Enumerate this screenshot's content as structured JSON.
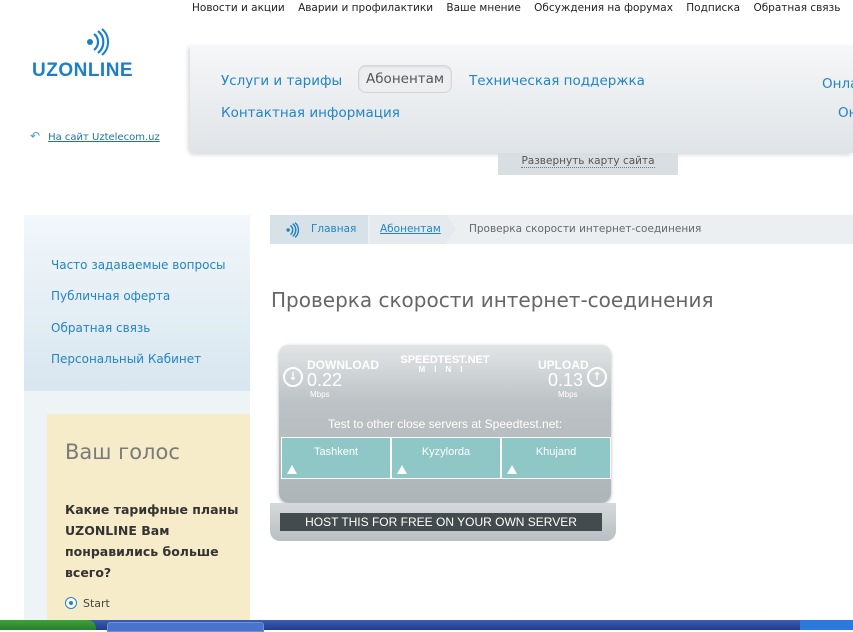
{
  "top_links": [
    "Новости и акции",
    "Аварии и профилактики",
    "Ваше мнение",
    "Обсуждения на форумах",
    "Подписка",
    "Обратная связь"
  ],
  "logo": {
    "text": "UZONLINE"
  },
  "back_link": "На сайт Uztelecom.uz",
  "nav": {
    "items": [
      "Услуги и тарифы",
      "Абонентам",
      "Техническая поддержка",
      "Контактная информация"
    ],
    "right_cut": [
      "Онла",
      "Он"
    ],
    "sitemap_label": "Развернуть карту сайта"
  },
  "left_menu": [
    "Часто задаваемые вопросы",
    "Публичная оферта",
    "Обратная связь",
    "Персональный Кабинет"
  ],
  "vote": {
    "title": "Ваш голос",
    "question": "Какие тарифные планы UZONLINE Вам понравились больше всего?",
    "option": "Start"
  },
  "breadcrumb": {
    "home": "Главная",
    "section": "Абонентам",
    "current": "Проверка скорости интернет-соединения"
  },
  "page_title": "Проверка скорости интернет-соединения",
  "speedtest": {
    "download_label": "DOWNLOAD",
    "download_value": "0.22",
    "upload_label": "UPLOAD",
    "upload_value": "0.13",
    "unit": "Mbps",
    "brand": "SPEEDTEST.NET",
    "brand_sub": "MINI",
    "test_text": "Test to other close servers at Speedtest.net:",
    "servers": [
      "Tashkent",
      "Kyzylorda",
      "Khujand"
    ],
    "host_button": "HOST THIS FOR FREE ON YOUR OWN SERVER"
  },
  "colors": {
    "accent": "#2385c3",
    "vote_bg": "#f6ecc9",
    "server_bg": "#8fc7c6"
  }
}
